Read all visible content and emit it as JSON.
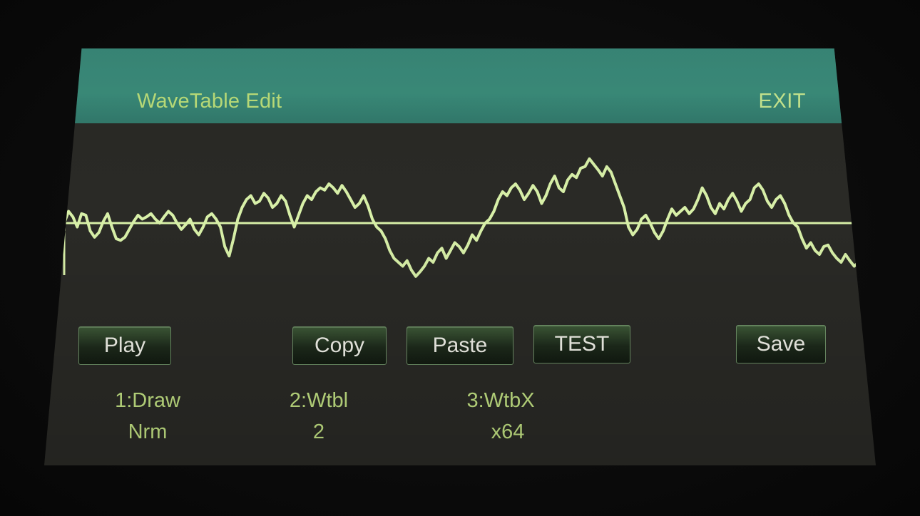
{
  "header": {
    "title": "WaveTable Edit",
    "exit_label": "EXIT"
  },
  "buttons": {
    "play": "Play",
    "copy": "Copy",
    "paste": "Paste",
    "test": "TEST",
    "save": "Save"
  },
  "params": [
    {
      "label": "1:Draw",
      "value": "Nrm"
    },
    {
      "label": "2:Wtbl",
      "value": "2"
    },
    {
      "label": "3:WtbX",
      "value": "x64"
    }
  ],
  "colors": {
    "header_bg": "#3b8d7b",
    "accent_text": "#c4e484",
    "waveform": "#d8f0a8",
    "screen_bg": "#2a2a26"
  },
  "waveform": {
    "samples": [
      0.0,
      0.15,
      0.08,
      -0.05,
      0.12,
      0.1,
      -0.1,
      -0.18,
      -0.12,
      0.02,
      0.12,
      -0.05,
      -0.2,
      -0.22,
      -0.18,
      -0.08,
      0.02,
      0.1,
      0.05,
      0.08,
      0.12,
      0.05,
      0.0,
      0.08,
      0.15,
      0.1,
      0.0,
      -0.08,
      -0.02,
      0.05,
      -0.08,
      -0.15,
      -0.05,
      0.08,
      0.12,
      0.05,
      -0.05,
      -0.3,
      -0.42,
      -0.2,
      0.05,
      0.2,
      0.3,
      0.35,
      0.25,
      0.28,
      0.38,
      0.32,
      0.2,
      0.25,
      0.35,
      0.28,
      0.1,
      -0.05,
      0.1,
      0.25,
      0.35,
      0.3,
      0.4,
      0.45,
      0.42,
      0.5,
      0.45,
      0.38,
      0.48,
      0.4,
      0.3,
      0.2,
      0.25,
      0.35,
      0.22,
      0.05,
      -0.05,
      -0.1,
      -0.2,
      -0.35,
      -0.45,
      -0.5,
      -0.55,
      -0.48,
      -0.6,
      -0.68,
      -0.62,
      -0.55,
      -0.45,
      -0.5,
      -0.38,
      -0.32,
      -0.45,
      -0.35,
      -0.25,
      -0.3,
      -0.38,
      -0.28,
      -0.15,
      -0.22,
      -0.1,
      0.0,
      0.05,
      0.15,
      0.3,
      0.4,
      0.35,
      0.45,
      0.5,
      0.42,
      0.3,
      0.38,
      0.48,
      0.4,
      0.25,
      0.35,
      0.5,
      0.6,
      0.45,
      0.4,
      0.55,
      0.62,
      0.58,
      0.7,
      0.72,
      0.82,
      0.75,
      0.68,
      0.6,
      0.72,
      0.65,
      0.5,
      0.35,
      0.2,
      -0.05,
      -0.15,
      -0.08,
      0.05,
      0.1,
      0.0,
      -0.12,
      -0.2,
      -0.1,
      0.05,
      0.18,
      0.1,
      0.15,
      0.2,
      0.12,
      0.18,
      0.3,
      0.45,
      0.35,
      0.2,
      0.12,
      0.25,
      0.18,
      0.3,
      0.38,
      0.28,
      0.15,
      0.25,
      0.3,
      0.45,
      0.5,
      0.42,
      0.28,
      0.2,
      0.3,
      0.35,
      0.25,
      0.1,
      0.0,
      -0.05,
      -0.2,
      -0.32,
      -0.25,
      -0.35,
      -0.4,
      -0.3,
      -0.28,
      -0.38,
      -0.45,
      -0.5,
      -0.4,
      -0.48,
      -0.55,
      -0.5,
      -0.58,
      -0.65,
      -0.7
    ]
  }
}
